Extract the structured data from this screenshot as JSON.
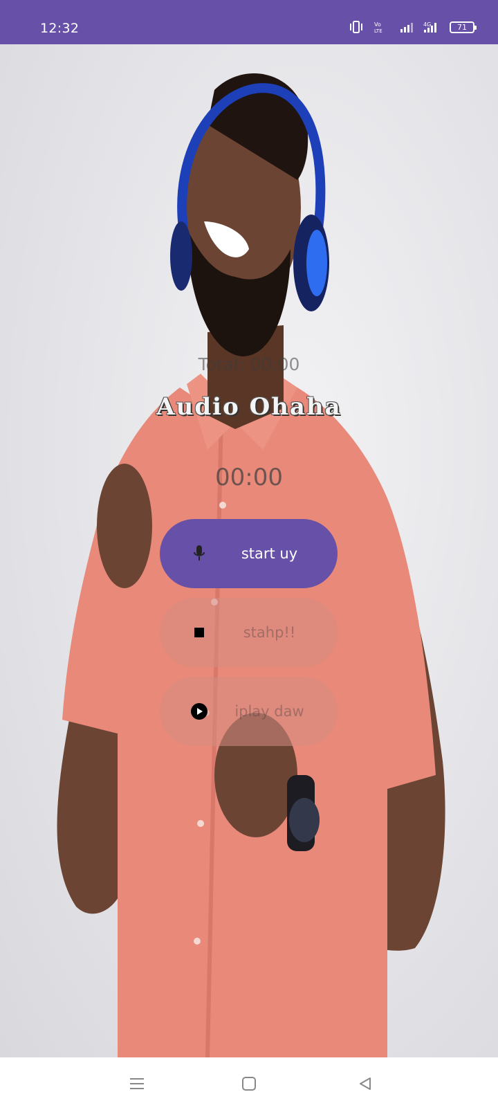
{
  "status_bar": {
    "time": "12:32",
    "battery": "71",
    "icons": [
      "vibrate-icon",
      "volte-icon",
      "signal-icon",
      "4g-signal-icon",
      "battery-icon"
    ]
  },
  "app": {
    "total_label": "Total: 00:00",
    "title": "Audio Ohaha",
    "timer": "00:00"
  },
  "buttons": {
    "start": {
      "label": "start uy",
      "icon": "microphone-icon"
    },
    "stop": {
      "label": "stahp!!",
      "icon": "stop-icon"
    },
    "play": {
      "label": "iplay daw",
      "icon": "play-icon"
    }
  },
  "nav": {
    "items": [
      "menu-icon",
      "home-icon",
      "back-icon"
    ]
  },
  "colors": {
    "accent": "#6650a8",
    "disabled_button": "#d68c82",
    "background": "#e6e6ea"
  }
}
